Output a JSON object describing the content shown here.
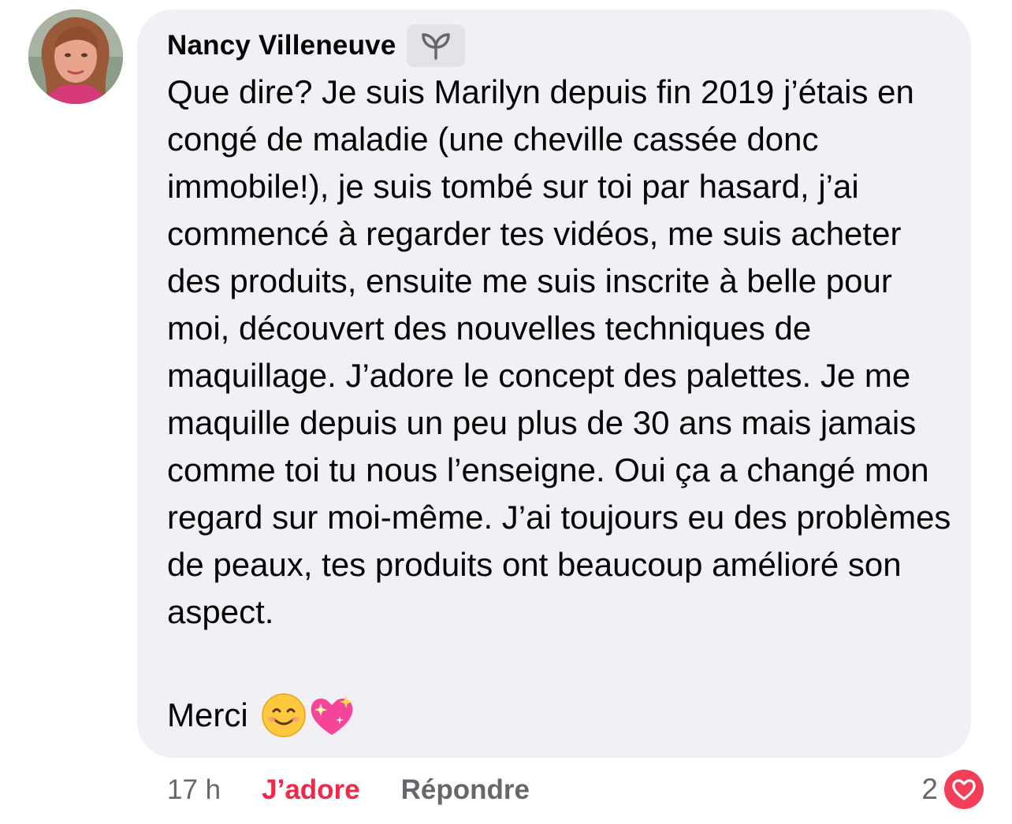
{
  "comment": {
    "author": "Nancy Villeneuve",
    "badge_icon": "sprout-icon",
    "paragraphs": [
      "Que dire? Je suis Marilyn depuis fin 2019 j’étais en congé de maladie (une cheville cassée donc immobile!), je suis tombé sur toi par hasard, j’ai commencé à regarder tes vidéos, me suis acheter des produits, ensuite me suis inscrite à belle pour moi, découvert des nouvelles techniques de maquillage. J’adore le concept des palettes. Je me maquille depuis un peu plus de 30 ans mais jamais comme toi tu nous l’enseigne. Oui ça a changé mon regard sur moi-même. J’ai toujours eu des problèmes de peaux, tes produits ont beaucoup amélioré son aspect."
    ],
    "closing": "Merci",
    "closing_emojis": [
      "smiling-face-icon",
      "sparkling-heart-icon"
    ]
  },
  "actions": {
    "time": "17 h",
    "like_label": "J’adore",
    "reply_label": "Répondre"
  },
  "reactions": {
    "count": "2",
    "icon": "heart-icon"
  },
  "colors": {
    "bubble": "#f0f0f5",
    "like_active": "#f02849",
    "muted": "#65676b",
    "heart": "#f33e58"
  }
}
